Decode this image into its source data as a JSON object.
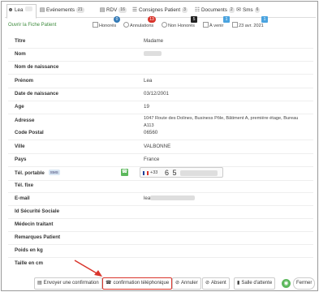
{
  "colors": {
    "accent_green": "#3d8b3d",
    "badge_blue": "#337ab7",
    "badge_red": "#d9342b",
    "badge_dark": "#222222",
    "badge_light_blue": "#4aa3df",
    "highlight_red": "#d9342b"
  },
  "tabs": [
    {
      "label": "Lea",
      "count": "",
      "icon": "user-icon"
    },
    {
      "label": "Evénements",
      "count": "21",
      "icon": "calendar-icon"
    },
    {
      "label": "RDV",
      "count": "16",
      "icon": "calendar-check-icon"
    },
    {
      "label": "Consignes Patient",
      "count": "3",
      "icon": "list-icon"
    },
    {
      "label": "Documents",
      "count": "2",
      "icon": "document-icon"
    },
    {
      "label": "Sms",
      "count": "6",
      "icon": "sms-icon"
    }
  ],
  "status": {
    "open_link": "Ouvrir la Fiche Patient",
    "chips": [
      {
        "label": "Honorés",
        "badge": "0"
      },
      {
        "label": "Annulations",
        "badge": "13"
      },
      {
        "label": "Non Honorés",
        "badge": "5"
      },
      {
        "label": "À venir",
        "badge": "1"
      },
      {
        "label": "23 avr. 2021",
        "badge": "1"
      }
    ]
  },
  "fields": {
    "titre": {
      "label": "Titre",
      "value": "Madame"
    },
    "nom": {
      "label": "Nom",
      "value": ""
    },
    "nom_naissance": {
      "label": "Nom de naissance",
      "value": ""
    },
    "prenom": {
      "label": "Prénom",
      "value": "Lea"
    },
    "date_naissance": {
      "label": "Date de naissance",
      "value": "03/12/2001"
    },
    "age": {
      "label": "Age",
      "value": "19"
    },
    "adresse": {
      "label": "Adresse",
      "value_line1": "1047 Route des Dolines, Business Pôle, Bâtiment A, première étage, Bureau",
      "value_line2": "A113"
    },
    "code_postal": {
      "label": "Code Postal",
      "value": "06560"
    },
    "ville": {
      "label": "Ville",
      "value": "VALBONNE"
    },
    "pays": {
      "label": "Pays",
      "value": "France"
    },
    "tel_portable": {
      "label": "Tél. portable",
      "sms_tag": "SMS",
      "dial_code": "+33",
      "number_prefix": "6 5"
    },
    "tel_fixe": {
      "label": "Tél. fixe",
      "value": ""
    },
    "email": {
      "label": "E-mail",
      "value_prefix": "lea"
    },
    "secu": {
      "label": "Id Sécurité Sociale",
      "value": ""
    },
    "medecin": {
      "label": "Médecin traitant",
      "value": ""
    },
    "remarques": {
      "label": "Remarques Patient",
      "value": ""
    },
    "poids": {
      "label": "Poids en kg",
      "value": ""
    },
    "taille": {
      "label": "Taille en cm",
      "value": ""
    }
  },
  "footer": {
    "send_confirmation": "Envoyer une confirmation",
    "phone_confirmation": "confirmation téléphonique",
    "cancel": "Annuler",
    "absent": "Absent",
    "waiting_room": "Salle d'attente",
    "close": "Fermer"
  }
}
